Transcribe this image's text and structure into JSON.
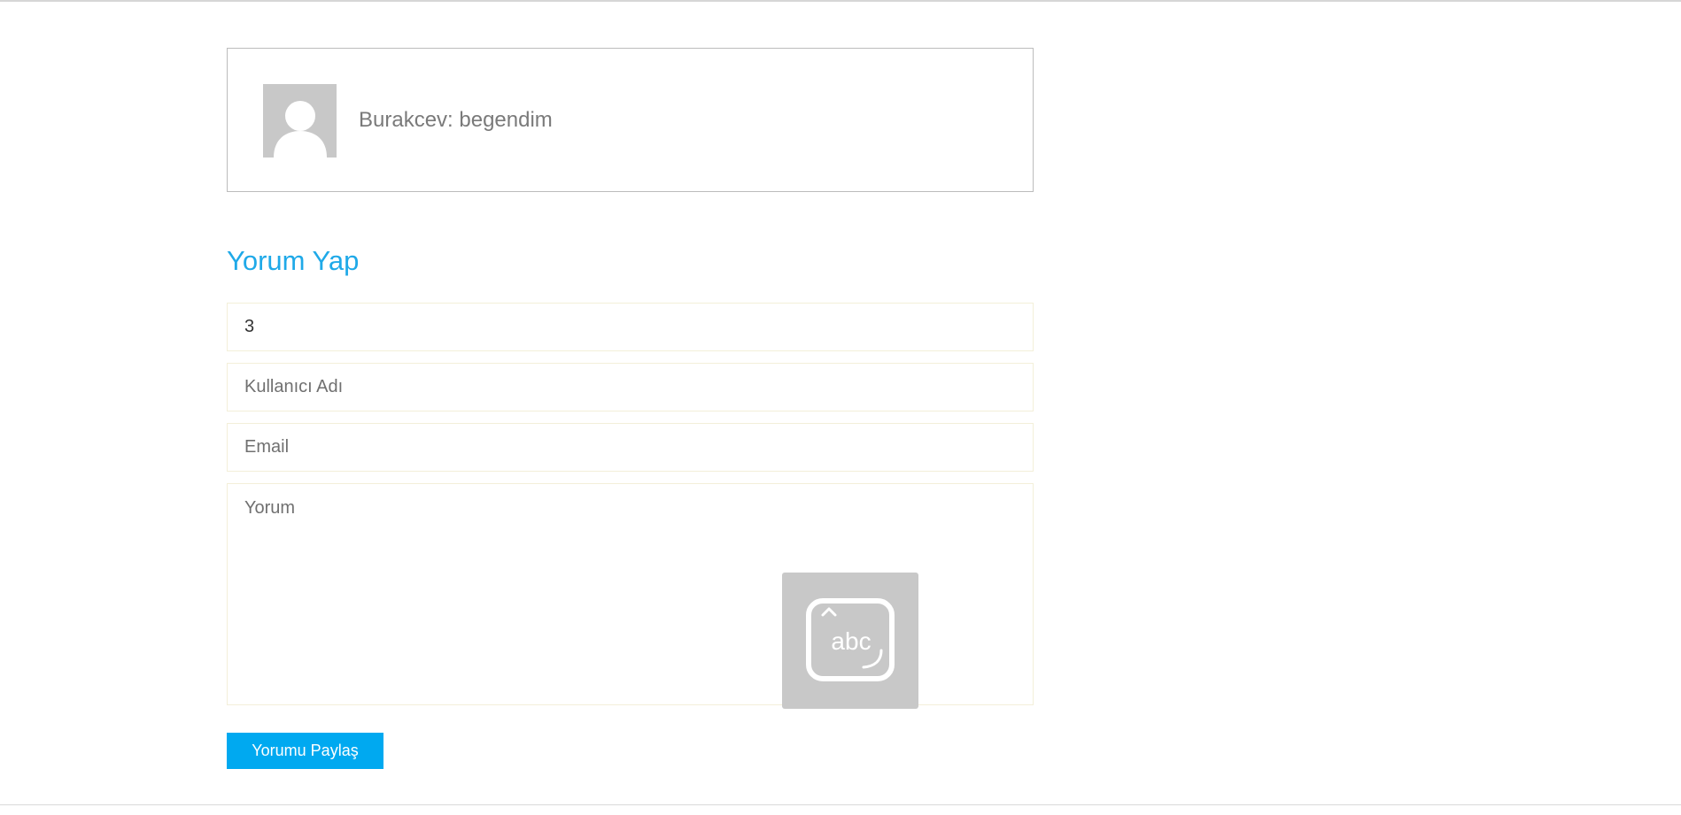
{
  "comment": {
    "author": "Burakcev",
    "separator": ": ",
    "text": "begendim",
    "avatar_icon": "default-user-avatar-icon"
  },
  "form": {
    "title": "Yorum Yap",
    "field1_value": "3",
    "username_placeholder": "Kullanıcı Adı",
    "email_placeholder": "Email",
    "comment_placeholder": "Yorum",
    "submit_label": "Yorumu Paylaş"
  },
  "overlay": {
    "icon": "handwriting-keyboard-icon",
    "label": "abc"
  },
  "colors": {
    "accent": "#1fa9e8",
    "button": "#00a9f0",
    "avatar_bg": "#c8c8c8"
  }
}
